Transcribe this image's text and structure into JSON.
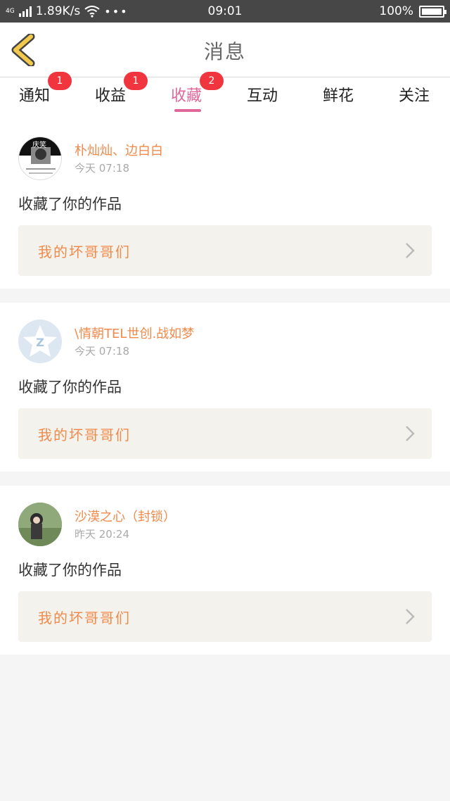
{
  "status_bar": {
    "network": "4G",
    "speed": "1.89K/s",
    "more": "•••",
    "time": "09:01",
    "battery": "100%",
    "battery_level": 1.0
  },
  "header": {
    "title": "消息",
    "back_icon": "chevron-left-icon",
    "accent_color": "#f2c94c"
  },
  "tabs": [
    {
      "label": "通知",
      "badge": "1"
    },
    {
      "label": "收益",
      "badge": "1"
    },
    {
      "label": "收藏",
      "badge": "2",
      "active": true
    },
    {
      "label": "互动",
      "badge": ""
    },
    {
      "label": "鲜花",
      "badge": ""
    },
    {
      "label": "关注",
      "badge": ""
    }
  ],
  "messages": [
    {
      "user": "朴灿灿、边白白",
      "time": "今天 07:18",
      "action": "收藏了你的作品",
      "work_title": "我的坏哥哥们",
      "avatar_text": "庆笑"
    },
    {
      "user": "\\情朝TEL世创.战如梦",
      "time": "今天 07:18",
      "action": "收藏了你的作品",
      "work_title": "我的坏哥哥们"
    },
    {
      "user": "沙漠之心（封锁）",
      "time": "昨天 20:24",
      "action": "收藏了你的作品",
      "work_title": "我的坏哥哥们"
    }
  ],
  "colors": {
    "active_tab": "#e0679a",
    "badge": "#f0353f",
    "username": "#f08a4b",
    "work_card_bg": "#f3f2ec"
  }
}
